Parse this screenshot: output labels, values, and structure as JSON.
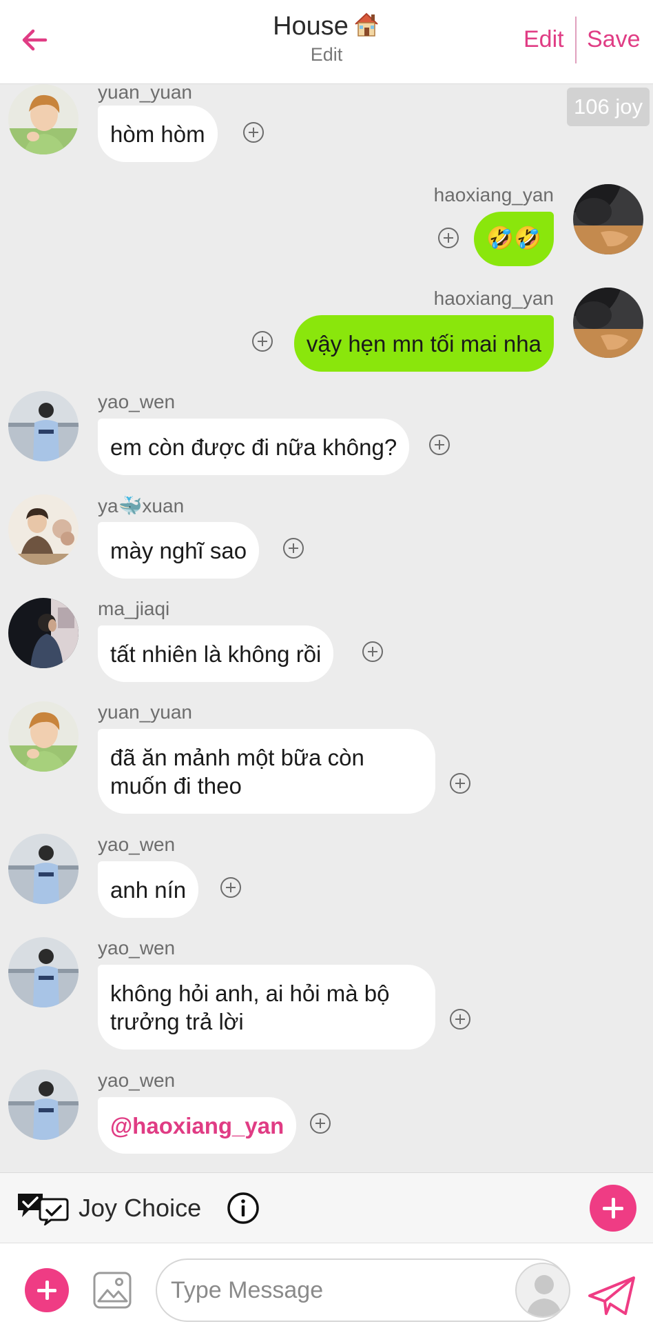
{
  "header": {
    "title": "House",
    "subtitle": "Edit",
    "edit_label": "Edit",
    "save_label": "Save",
    "accent_color": "#e03c84"
  },
  "joy_badge": "106 joy",
  "messages": [
    {
      "side": "left",
      "user": "yuan_yuan",
      "text": "hòm hòm",
      "avatar": "avatar-yuan-yuan"
    },
    {
      "side": "right",
      "user": "haoxiang_yan",
      "text": "🤣🤣",
      "avatar": "avatar-haoxiang-yan"
    },
    {
      "side": "right",
      "user": "haoxiang_yan",
      "text": "vậy hẹn mn tối mai nha",
      "avatar": "avatar-haoxiang-yan"
    },
    {
      "side": "left",
      "user": "yao_wen",
      "text": "em còn được đi nữa không?",
      "avatar": "avatar-yao-wen"
    },
    {
      "side": "left",
      "user": "ya🐳xuan",
      "text": "mày nghĩ sao",
      "avatar": "avatar-ya-xuan"
    },
    {
      "side": "left",
      "user": "ma_jiaqi",
      "text": "tất nhiên là không rồi",
      "avatar": "avatar-ma-jiaqi"
    },
    {
      "side": "left",
      "user": "yuan_yuan",
      "text": "đã ăn mảnh một bữa còn",
      "text2": "muốn đi theo",
      "avatar": "avatar-yuan-yuan"
    },
    {
      "side": "left",
      "user": "yao_wen",
      "text": "anh nín",
      "avatar": "avatar-yao-wen"
    },
    {
      "side": "left",
      "user": "yao_wen",
      "text": "không hỏi anh, ai hỏi mà bộ",
      "text2": "trưởng trả lời",
      "avatar": "avatar-yao-wen"
    },
    {
      "side": "left",
      "user": "yao_wen",
      "text": "@haoxiang_yan",
      "mention": true,
      "avatar": "avatar-yao-wen"
    }
  ],
  "joy_choice": {
    "label": "Joy Choice"
  },
  "composer": {
    "placeholder": "Type Message"
  },
  "colors": {
    "bubble_sent": "#8ae60c",
    "bubble_received": "#ffffff",
    "chat_background": "#ececec",
    "button_pink": "#ef3c84"
  },
  "icons": [
    "back-arrow-icon",
    "house-emoji-icon",
    "plus-circle-icon",
    "joy-choice-icon",
    "info-icon",
    "add-icon",
    "image-icon",
    "user-icon",
    "send-icon"
  ]
}
